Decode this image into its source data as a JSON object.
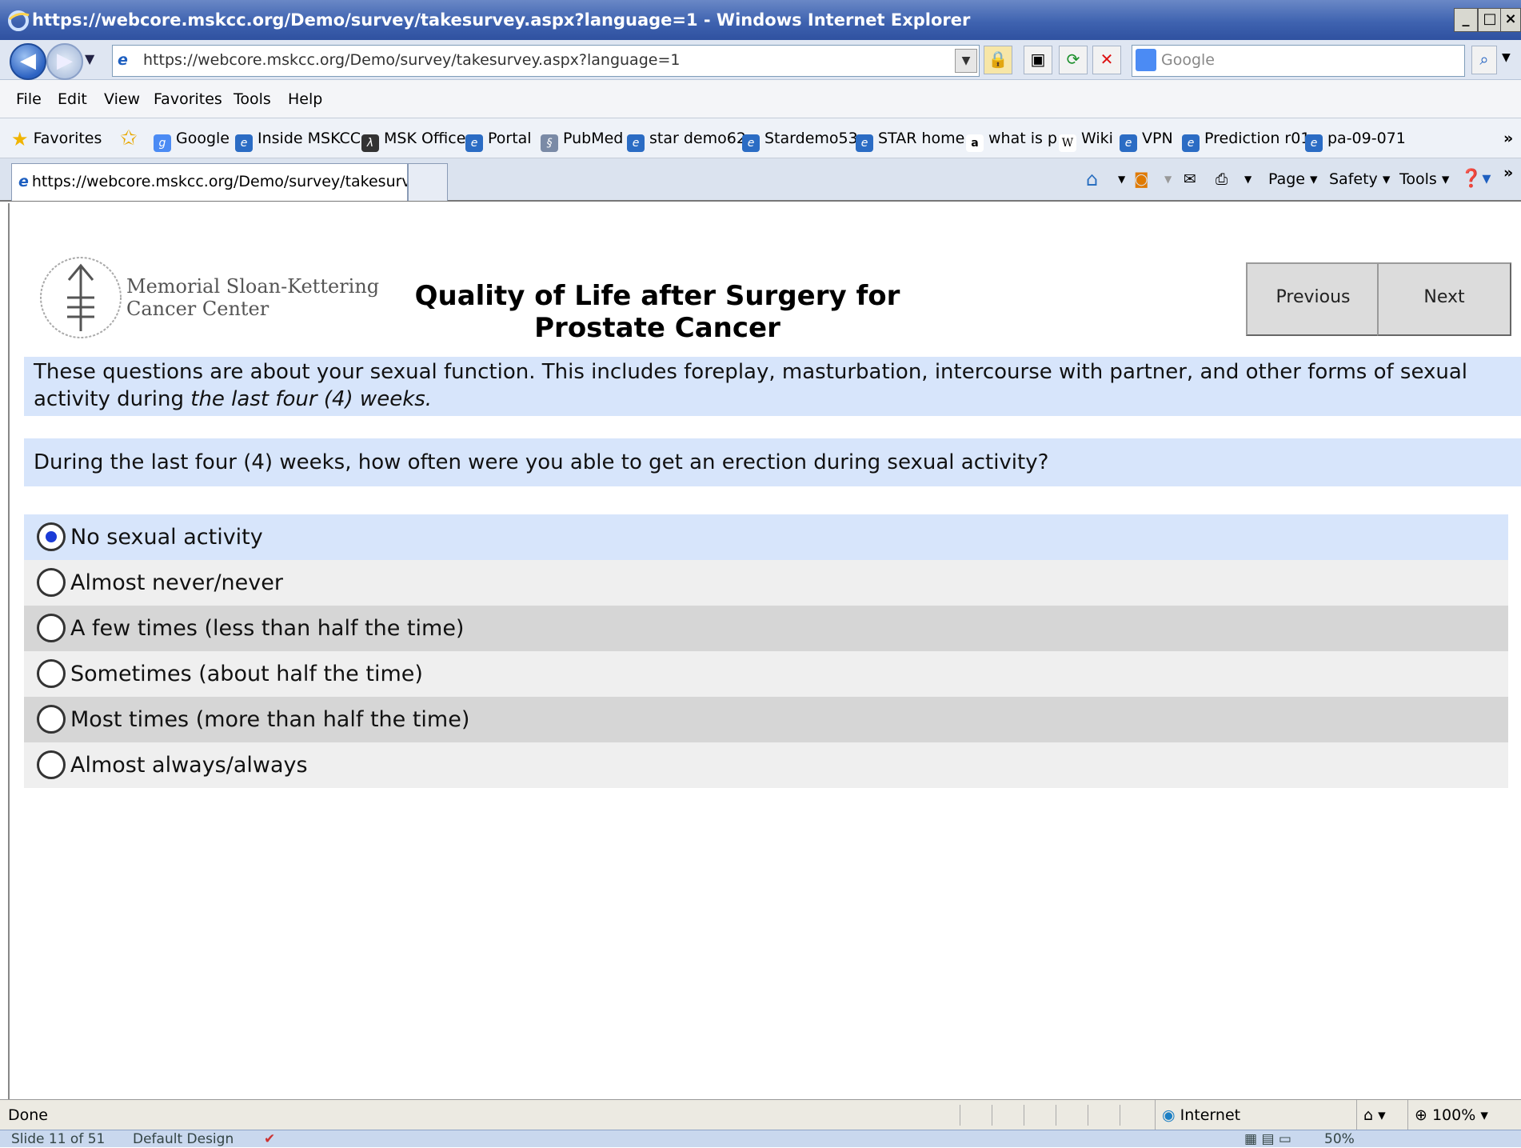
{
  "browser": {
    "window_title": "https://webcore.mskcc.org/Demo/survey/takesurvey.aspx?language=1 - Windows Internet Explorer",
    "address": "https://webcore.mskcc.org/Demo/survey/takesurvey.aspx?language=1",
    "search_placeholder": "Google",
    "menu": [
      "File",
      "Edit",
      "View",
      "Favorites",
      "Tools",
      "Help"
    ],
    "favorites_label": "Favorites",
    "favorites": [
      "Google",
      "Inside MSKCC",
      "MSK Office",
      "Portal",
      "PubMed",
      "star demo62",
      "Stardemo53",
      "STAR home",
      "what is p",
      "Wiki",
      "VPN",
      "Prediction r01",
      "pa-09-071"
    ],
    "tab_title": "https://webcore.mskcc.org/Demo/survey/takesurvey...",
    "commands": [
      "Page",
      "Safety",
      "Tools"
    ]
  },
  "page": {
    "org_line1": "Memorial Sloan-Kettering",
    "org_line2": "Cancer Center",
    "title": "Quality of Life after Surgery for Prostate Cancer",
    "previous_label": "Previous",
    "next_label": "Next",
    "intro_text": "These questions are about your sexual function. This includes foreplay, masturbation, intercourse with partner, and other forms of sexual activity during ",
    "intro_italic": "the last four (4) weeks.",
    "question": "During the last four (4) weeks, how often were you able to get an erection during sexual activity?",
    "options": [
      {
        "label": "No sexual activity",
        "selected": true
      },
      {
        "label": "Almost never/never",
        "selected": false
      },
      {
        "label": "A few times (less than half the time)",
        "selected": false
      },
      {
        "label": "Sometimes (about half the time)",
        "selected": false
      },
      {
        "label": "Most times (more than half the time)",
        "selected": false
      },
      {
        "label": "Almost always/always",
        "selected": false
      }
    ]
  },
  "status": {
    "left_text": "Done",
    "zone": "Internet",
    "zoom": "100%",
    "ppt_slide": "Slide 11 of 51",
    "ppt_design": "Default Design",
    "ppt_zoom": "50%"
  },
  "colors": {
    "highlight_row": "#d7e5fb",
    "alt_row_light": "#efefef",
    "alt_row_dark": "#d6d6d6",
    "title_bar": "#3f63b0",
    "radio_dot": "#1b3bd6"
  }
}
